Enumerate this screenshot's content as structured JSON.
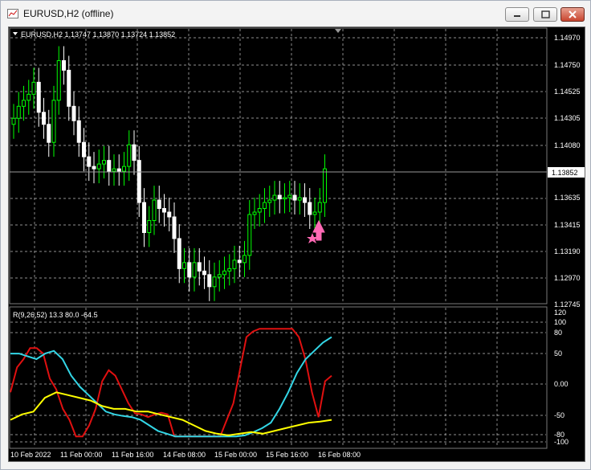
{
  "window": {
    "title": "EURUSD,H2 (offline)",
    "buttons": [
      "minimize",
      "maximize",
      "close"
    ]
  },
  "chart": {
    "info_line": "EURUSD,H2  1.13747 1.13870 1.13724 1.13852",
    "price_axis": [
      "1.14970",
      "1.14750",
      "1.14525",
      "1.14305",
      "1.14080",
      "1.13635",
      "1.13415",
      "1.13190",
      "1.12970",
      "1.12745"
    ],
    "current_price": "1.13852",
    "time_axis": [
      "10 Feb 2022",
      "11 Feb 00:00",
      "11 Feb 16:00",
      "14 Feb 08:00",
      "15 Feb 00:00",
      "15 Feb 16:00",
      "16 Feb 08:00"
    ],
    "colors": {
      "bull": "#00ff00",
      "bear": "#ffffff",
      "signal": "#ff69b4",
      "grid": "#c0c0c0"
    }
  },
  "indicator": {
    "label": "R(9,26,52) 13.3 80.0 -64.5",
    "axis": [
      "120",
      "100",
      "80",
      "50",
      "0.00",
      "-50",
      "-80",
      "-100"
    ],
    "colors": {
      "line1": "#e01010",
      "line2": "#33d6e6",
      "line3": "#ffff00"
    }
  },
  "chart_data": {
    "type": "line",
    "x": [
      0,
      1,
      2,
      3,
      4,
      5,
      6,
      7,
      8,
      9,
      10,
      11,
      12,
      13,
      14,
      15,
      16,
      17,
      18,
      19,
      20,
      21,
      22,
      23,
      24,
      25,
      26,
      27,
      28,
      29,
      30,
      31,
      32,
      33,
      34,
      35,
      36,
      37,
      38,
      39,
      40,
      41,
      42,
      43,
      44,
      45,
      46,
      47,
      48,
      49,
      50,
      51,
      52,
      53,
      54,
      55,
      56,
      57,
      58,
      59,
      60,
      61,
      62,
      63,
      64,
      65
    ],
    "ohlc_close": [
      1.143,
      1.144,
      1.1445,
      1.145,
      1.146,
      1.1435,
      1.1425,
      1.141,
      1.1445,
      1.1478,
      1.147,
      1.144,
      1.1428,
      1.141,
      1.1398,
      1.139,
      1.1388,
      1.1392,
      1.1395,
      1.1386,
      1.1388,
      1.1386,
      1.139,
      1.1408,
      1.1395,
      1.136,
      1.1335,
      1.1345,
      1.1362,
      1.1355,
      1.1352,
      1.1348,
      1.133,
      1.1305,
      1.131,
      1.1298,
      1.131,
      1.1303,
      1.13,
      1.129,
      1.1298,
      1.13,
      1.1303,
      1.1305,
      1.1312,
      1.131,
      1.1316,
      1.135,
      1.1352,
      1.1355,
      1.136,
      1.1362,
      1.1366,
      1.1363,
      1.1364,
      1.1366,
      1.1362,
      1.1364,
      1.136,
      1.135,
      1.1352,
      1.136,
      1.1388
    ],
    "series": [
      {
        "name": "",
        "values": [
          -20,
          25,
          40,
          60,
          60,
          50,
          5,
          -15,
          -50,
          -70,
          -100,
          -100,
          -80,
          -50,
          0,
          20,
          10,
          -15,
          -40,
          -58,
          -60,
          -65,
          -60,
          -57,
          -60,
          -100,
          -100,
          -100,
          -100,
          -100,
          -100,
          -100,
          -100,
          -70,
          -40,
          20,
          80,
          90,
          95,
          95,
          95,
          95,
          95,
          95,
          80,
          40,
          -20,
          -65,
          0,
          10
        ]
      },
      {
        "name": "",
        "values": [
          50,
          50,
          45,
          40,
          50,
          55,
          40,
          10,
          -10,
          -25,
          -40,
          -55,
          -60,
          -63,
          -65,
          -70,
          -80,
          -90,
          -95,
          -100,
          -100,
          -100,
          -100,
          -100,
          -100,
          -100,
          -100,
          -98,
          -92,
          -85,
          -75,
          -50,
          -20,
          15,
          40,
          55,
          70,
          80
        ]
      },
      {
        "name": "",
        "values": [
          -70,
          -60,
          -55,
          -30,
          -20,
          -25,
          -30,
          -35,
          -45,
          -50,
          -50,
          -55,
          -55,
          -60,
          -65,
          -70,
          -80,
          -90,
          -95,
          -98,
          -95,
          -92,
          -95,
          -90,
          -85,
          -80,
          -75,
          -73,
          -70
        ]
      }
    ],
    "ylim": [
      -120,
      120
    ]
  }
}
